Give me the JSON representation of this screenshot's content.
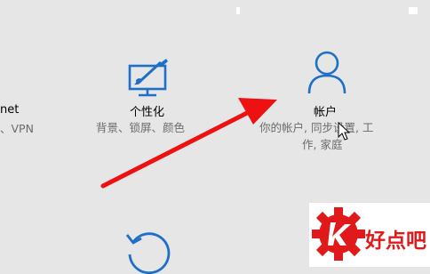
{
  "network_tile": {
    "title": "net",
    "description": "、VPN"
  },
  "personalization_tile": {
    "icon": "paint-brush-monitor-icon",
    "title": "个性化",
    "description": "背景、锁屏、颜色"
  },
  "accounts_tile": {
    "icon": "person-icon",
    "title": "帐户",
    "description_line1": "你的帐户, 同步设置, 工",
    "description_line2": "作, 家庭"
  },
  "update_tile": {
    "icon": "refresh-icon"
  },
  "annotation": {
    "arrow_color": "#ee1111"
  },
  "watermark": {
    "text": "好点吧",
    "color": "#e01a1a"
  },
  "accent_color": "#1e6fc8"
}
